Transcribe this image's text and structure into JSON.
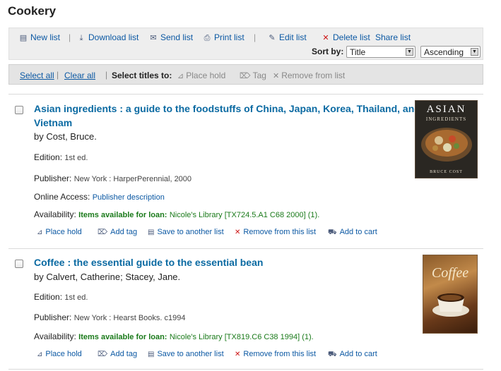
{
  "page": {
    "title": "Cookery"
  },
  "toolbar": {
    "new_list": "New list",
    "download_list": "Download list",
    "send_list": "Send list",
    "print_list": "Print list",
    "edit_list": "Edit list",
    "delete_list": "Delete list",
    "share_list": "Share list",
    "sort_by_label": "Sort by:",
    "sort_field": "Title",
    "sort_order": "Ascending"
  },
  "selection": {
    "select_all": "Select all",
    "clear_all": "Clear all",
    "select_titles_to": "Select titles to:",
    "place_hold": "Place hold",
    "tag": "Tag",
    "remove_from_list": "Remove from list"
  },
  "results": [
    {
      "title_line1": "Asian ingredients : a guide to the foodstuffs of China, Japan, Korea, Thailand, and",
      "title_line2": "Vietnam",
      "author": "by Cost, Bruce.",
      "edition_label": "Edition:",
      "edition": "1st ed.",
      "publisher_label": "Publisher:",
      "publisher": "New York : HarperPerennial, 2000",
      "online_label": "Online Access:",
      "online": "Publisher description",
      "availability_label": "Availability:",
      "availability_status": "Items available for loan:",
      "availability_detail": "Nicole's Library [TX724.5.A1 C68 2000] (1).",
      "cover_title": "ASIAN",
      "cover_subtitle": "INGREDIENTS",
      "cover_author": "BRUCE COST"
    },
    {
      "title_line1": "Coffee : the essential guide to the essential bean",
      "author": "by Calvert, Catherine; Stacey, Jane.",
      "edition_label": "Edition:",
      "edition": "1st ed.",
      "publisher_label": "Publisher:",
      "publisher": "New York : Hearst Books. c1994",
      "availability_label": "Availability:",
      "availability_status": "Items available for loan:",
      "availability_detail": "Nicole's Library [TX819.C6 C38 1994] (1).",
      "cover_title": "Coffee"
    }
  ],
  "actions": {
    "place_hold": "Place hold",
    "add_tag": "Add tag",
    "save_to_another_list": "Save to another list",
    "remove_from_this_list": "Remove from this list",
    "add_to_cart": "Add to cart"
  }
}
